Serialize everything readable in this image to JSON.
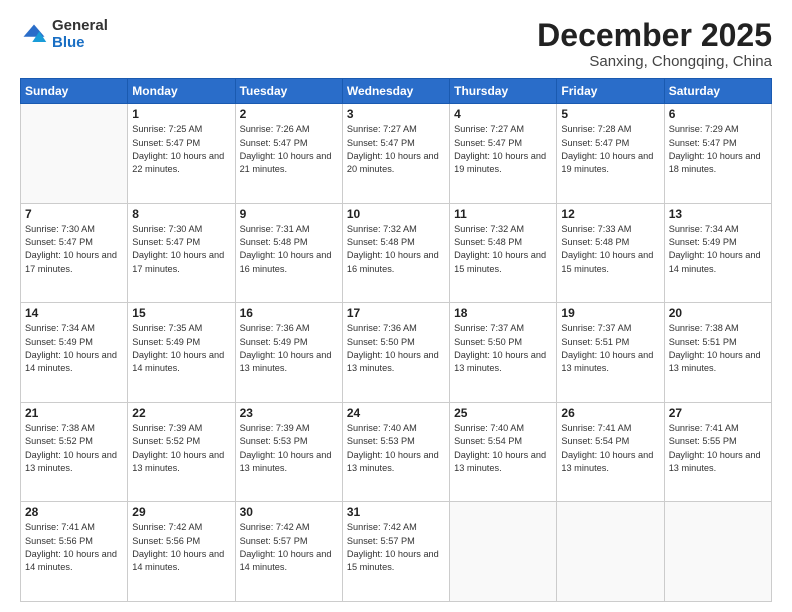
{
  "header": {
    "logo_general": "General",
    "logo_blue": "Blue",
    "month_title": "December 2025",
    "location": "Sanxing, Chongqing, China"
  },
  "days_of_week": [
    "Sunday",
    "Monday",
    "Tuesday",
    "Wednesday",
    "Thursday",
    "Friday",
    "Saturday"
  ],
  "weeks": [
    [
      {
        "day": "",
        "info": ""
      },
      {
        "day": "1",
        "info": "Sunrise: 7:25 AM\nSunset: 5:47 PM\nDaylight: 10 hours\nand 22 minutes."
      },
      {
        "day": "2",
        "info": "Sunrise: 7:26 AM\nSunset: 5:47 PM\nDaylight: 10 hours\nand 21 minutes."
      },
      {
        "day": "3",
        "info": "Sunrise: 7:27 AM\nSunset: 5:47 PM\nDaylight: 10 hours\nand 20 minutes."
      },
      {
        "day": "4",
        "info": "Sunrise: 7:27 AM\nSunset: 5:47 PM\nDaylight: 10 hours\nand 19 minutes."
      },
      {
        "day": "5",
        "info": "Sunrise: 7:28 AM\nSunset: 5:47 PM\nDaylight: 10 hours\nand 19 minutes."
      },
      {
        "day": "6",
        "info": "Sunrise: 7:29 AM\nSunset: 5:47 PM\nDaylight: 10 hours\nand 18 minutes."
      }
    ],
    [
      {
        "day": "7",
        "info": "Sunrise: 7:30 AM\nSunset: 5:47 PM\nDaylight: 10 hours\nand 17 minutes."
      },
      {
        "day": "8",
        "info": "Sunrise: 7:30 AM\nSunset: 5:47 PM\nDaylight: 10 hours\nand 17 minutes."
      },
      {
        "day": "9",
        "info": "Sunrise: 7:31 AM\nSunset: 5:48 PM\nDaylight: 10 hours\nand 16 minutes."
      },
      {
        "day": "10",
        "info": "Sunrise: 7:32 AM\nSunset: 5:48 PM\nDaylight: 10 hours\nand 16 minutes."
      },
      {
        "day": "11",
        "info": "Sunrise: 7:32 AM\nSunset: 5:48 PM\nDaylight: 10 hours\nand 15 minutes."
      },
      {
        "day": "12",
        "info": "Sunrise: 7:33 AM\nSunset: 5:48 PM\nDaylight: 10 hours\nand 15 minutes."
      },
      {
        "day": "13",
        "info": "Sunrise: 7:34 AM\nSunset: 5:49 PM\nDaylight: 10 hours\nand 14 minutes."
      }
    ],
    [
      {
        "day": "14",
        "info": "Sunrise: 7:34 AM\nSunset: 5:49 PM\nDaylight: 10 hours\nand 14 minutes."
      },
      {
        "day": "15",
        "info": "Sunrise: 7:35 AM\nSunset: 5:49 PM\nDaylight: 10 hours\nand 14 minutes."
      },
      {
        "day": "16",
        "info": "Sunrise: 7:36 AM\nSunset: 5:49 PM\nDaylight: 10 hours\nand 13 minutes."
      },
      {
        "day": "17",
        "info": "Sunrise: 7:36 AM\nSunset: 5:50 PM\nDaylight: 10 hours\nand 13 minutes."
      },
      {
        "day": "18",
        "info": "Sunrise: 7:37 AM\nSunset: 5:50 PM\nDaylight: 10 hours\nand 13 minutes."
      },
      {
        "day": "19",
        "info": "Sunrise: 7:37 AM\nSunset: 5:51 PM\nDaylight: 10 hours\nand 13 minutes."
      },
      {
        "day": "20",
        "info": "Sunrise: 7:38 AM\nSunset: 5:51 PM\nDaylight: 10 hours\nand 13 minutes."
      }
    ],
    [
      {
        "day": "21",
        "info": "Sunrise: 7:38 AM\nSunset: 5:52 PM\nDaylight: 10 hours\nand 13 minutes."
      },
      {
        "day": "22",
        "info": "Sunrise: 7:39 AM\nSunset: 5:52 PM\nDaylight: 10 hours\nand 13 minutes."
      },
      {
        "day": "23",
        "info": "Sunrise: 7:39 AM\nSunset: 5:53 PM\nDaylight: 10 hours\nand 13 minutes."
      },
      {
        "day": "24",
        "info": "Sunrise: 7:40 AM\nSunset: 5:53 PM\nDaylight: 10 hours\nand 13 minutes."
      },
      {
        "day": "25",
        "info": "Sunrise: 7:40 AM\nSunset: 5:54 PM\nDaylight: 10 hours\nand 13 minutes."
      },
      {
        "day": "26",
        "info": "Sunrise: 7:41 AM\nSunset: 5:54 PM\nDaylight: 10 hours\nand 13 minutes."
      },
      {
        "day": "27",
        "info": "Sunrise: 7:41 AM\nSunset: 5:55 PM\nDaylight: 10 hours\nand 13 minutes."
      }
    ],
    [
      {
        "day": "28",
        "info": "Sunrise: 7:41 AM\nSunset: 5:56 PM\nDaylight: 10 hours\nand 14 minutes."
      },
      {
        "day": "29",
        "info": "Sunrise: 7:42 AM\nSunset: 5:56 PM\nDaylight: 10 hours\nand 14 minutes."
      },
      {
        "day": "30",
        "info": "Sunrise: 7:42 AM\nSunset: 5:57 PM\nDaylight: 10 hours\nand 14 minutes."
      },
      {
        "day": "31",
        "info": "Sunrise: 7:42 AM\nSunset: 5:57 PM\nDaylight: 10 hours\nand 15 minutes."
      },
      {
        "day": "",
        "info": ""
      },
      {
        "day": "",
        "info": ""
      },
      {
        "day": "",
        "info": ""
      }
    ]
  ]
}
